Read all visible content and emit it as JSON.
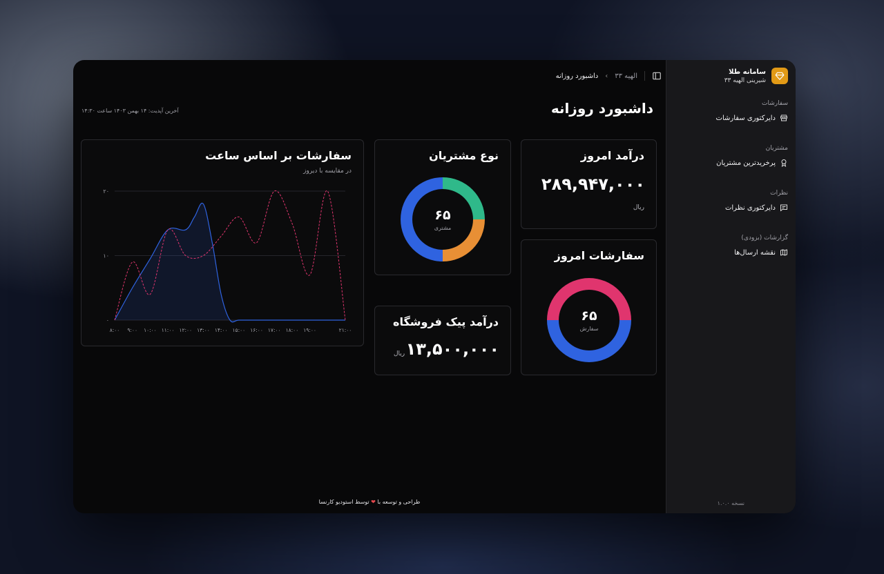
{
  "sidebar": {
    "brand_title": "سامانه طلا",
    "brand_subtitle": "شیرینی الهیه ۳۳",
    "groups": [
      {
        "label": "سفارشات",
        "item": "دایرکتوری سفارشات"
      },
      {
        "label": "مشتریان",
        "item": "پرخریدترین مشتریان"
      },
      {
        "label": "نظرات",
        "item": "دایرکتوری نظرات"
      },
      {
        "label": "گزارشات (بزودی)",
        "item": "نقشه ارسال‌ها"
      }
    ],
    "version": "نسخه ۱.۰.۰"
  },
  "breadcrumb": {
    "parent": "الهیه ۳۳",
    "current": "داشبورد روزانه"
  },
  "page": {
    "title": "داشبورد روزانه",
    "last_update": "آخرین آپدیت: ۱۴ بهمن ۱۴۰۳ ساعت ۱۴:۳۰"
  },
  "revenue_card": {
    "title": "درآمد امروز",
    "value": "۲۸۹,۹۴۷,۰۰۰",
    "unit": "ریال"
  },
  "orders_card": {
    "title": "سفارشات امروز",
    "value": "۶۵",
    "label": "سفارش"
  },
  "customers_card": {
    "title": "نوع مشتریان",
    "value": "۶۵",
    "label": "مشتری"
  },
  "peak_card": {
    "title": "درآمد پیک فروشگاه",
    "value": "۱۳,۵۰۰,۰۰۰",
    "unit": "ریال"
  },
  "hourly_card": {
    "title": "سفارشات بر اساس ساعت",
    "subtitle": "در مقایسه با دیروز"
  },
  "colors": {
    "accent": "#e29a16",
    "blue": "#2f63e0",
    "pink": "#e0356e",
    "green": "#2fb98a",
    "orange": "#e88f35"
  },
  "footer": {
    "before": "طراحی و توسعه با",
    "after": "توسط استودیو کارنسا"
  },
  "chart_data": [
    {
      "type": "pie",
      "values": [
        50,
        50
      ],
      "colors": [
        "#2f63e0",
        "#e0356e"
      ]
    },
    {
      "type": "pie",
      "values": [
        25,
        25,
        50
      ],
      "colors": [
        "#2fb98a",
        "#e88f35",
        "#2f63e0"
      ]
    },
    {
      "type": "area",
      "x": [
        "۸:۰۰",
        "۹:۰۰",
        "۱۰:۰۰",
        "۱۱:۰۰",
        "۱۲:۰۰",
        "۱۳:۰۰",
        "۱۴:۰۰",
        "۱۵:۰۰",
        "۱۶:۰۰",
        "۱۷:۰۰",
        "۱۸:۰۰",
        "۱۹:۰۰",
        "۲۱:۰۰"
      ],
      "x_values": [
        8,
        9,
        10,
        11,
        12,
        13,
        14,
        15,
        16,
        17,
        18,
        19,
        21
      ],
      "xlim": [
        8,
        21
      ],
      "ylim": [
        0,
        20
      ],
      "yticks": [
        0,
        10,
        20
      ],
      "ytick_labels": [
        "۰",
        "۱۰",
        "۲۰"
      ],
      "grid": true,
      "series": [
        {
          "style": "solid-area",
          "color": "#2f63e0",
          "points": [
            [
              8,
              0
            ],
            [
              9,
              5
            ],
            [
              10,
              9.5
            ],
            [
              11,
              14
            ],
            [
              12,
              14
            ],
            [
              12.5,
              16
            ],
            [
              13,
              18
            ],
            [
              13.5,
              12
            ],
            [
              14,
              4
            ],
            [
              14.5,
              0
            ],
            [
              15,
              0
            ],
            [
              16,
              0
            ],
            [
              17,
              0
            ],
            [
              18,
              0
            ],
            [
              19,
              0
            ],
            [
              21,
              0
            ]
          ]
        },
        {
          "style": "dashed",
          "color": "#e0356e",
          "points": [
            [
              8,
              0
            ],
            [
              9,
              9
            ],
            [
              10,
              4
            ],
            [
              11,
              14
            ],
            [
              12,
              10
            ],
            [
              13,
              10
            ],
            [
              14,
              13
            ],
            [
              15,
              16
            ],
            [
              16,
              12
            ],
            [
              17,
              20
            ],
            [
              18,
              15
            ],
            [
              19,
              7
            ],
            [
              20,
              20
            ],
            [
              21,
              0
            ]
          ]
        }
      ]
    }
  ]
}
